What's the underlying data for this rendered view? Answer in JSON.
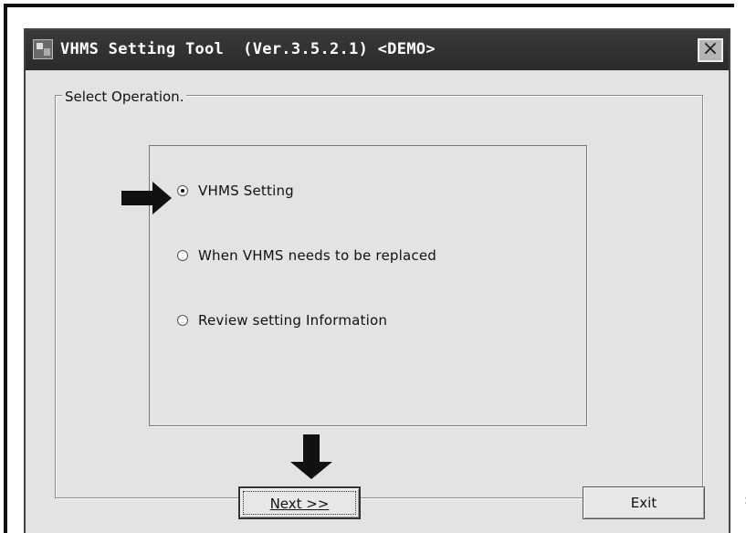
{
  "window": {
    "title": "VHMS Setting Tool  (Ver.3.5.2.1) <DEMO>",
    "close_label": "×"
  },
  "group": {
    "legend": "Select Operation."
  },
  "options": [
    {
      "label": "VHMS Setting",
      "selected": true
    },
    {
      "label": "When VHMS needs to be replaced",
      "selected": false
    },
    {
      "label": "Review setting Information",
      "selected": false
    }
  ],
  "buttons": {
    "next_label": "Next >>",
    "exit_label": "Exit"
  },
  "margin_char": ":",
  "colors": {
    "titlebar": "#2e2e2e",
    "dialog_bg": "#e3e3e3",
    "arrow": "#111111"
  }
}
